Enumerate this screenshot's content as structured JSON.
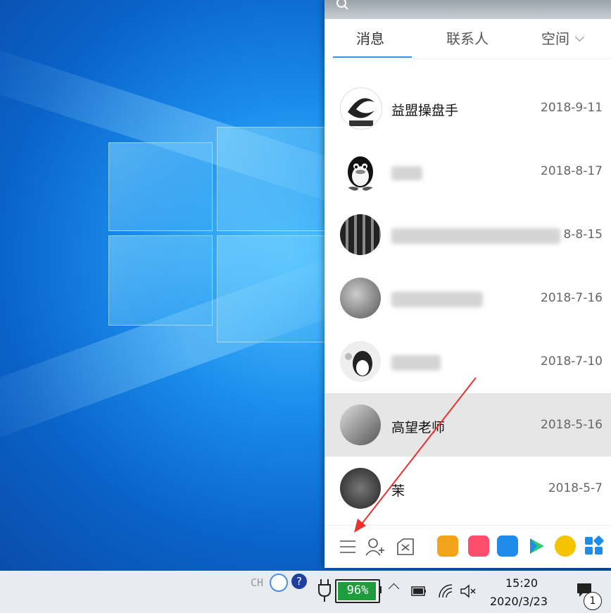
{
  "panel": {
    "tabs": [
      {
        "label": "消息"
      },
      {
        "label": "联系人"
      },
      {
        "label": "空间"
      }
    ],
    "contacts": [
      {
        "name": "益盟操盘手",
        "date": "2018-9-11",
        "avatar": "eastmoney-logo",
        "selected": false
      },
      {
        "name": "",
        "date": "2018-8-17",
        "avatar": "qq-penguin",
        "selected": false
      },
      {
        "name": "",
        "date": "8-8-15",
        "avatar": "dark-group",
        "selected": false
      },
      {
        "name": "",
        "date": "2018-7-16",
        "avatar": "photo",
        "selected": false
      },
      {
        "name": "",
        "date": "2018-7-10",
        "avatar": "penguin-pink",
        "selected": false
      },
      {
        "name": "高望老师",
        "date": "2018-5-16",
        "avatar": "person-desk",
        "selected": true
      },
      {
        "name": "茉",
        "date": "2018-5-7",
        "avatar": "crowd",
        "selected": false
      }
    ],
    "bottom_icons": [
      "menu-icon",
      "add-contact-icon",
      "app-manager-icon"
    ],
    "app_icons": [
      {
        "name": "game-icon",
        "color": "#f2a31a"
      },
      {
        "name": "live-icon",
        "color": "#ff4d6d"
      },
      {
        "name": "weiyun-icon",
        "color": "#1e8ce8"
      },
      {
        "name": "video-icon",
        "color": "#2ecc71"
      },
      {
        "name": "music-icon",
        "color": "#f5c400"
      },
      {
        "name": "more-apps-icon",
        "color": "#1e8ce8"
      }
    ]
  },
  "taskbar": {
    "ime": "CH",
    "battery_percent": "96%",
    "battery_level": 0.96,
    "time": "15:20",
    "date": "2020/3/23",
    "notification_count": "1"
  },
  "colors": {
    "accent": "#3a8ee6",
    "battery": "#1e9d3c",
    "arrow": "#e8322c"
  }
}
